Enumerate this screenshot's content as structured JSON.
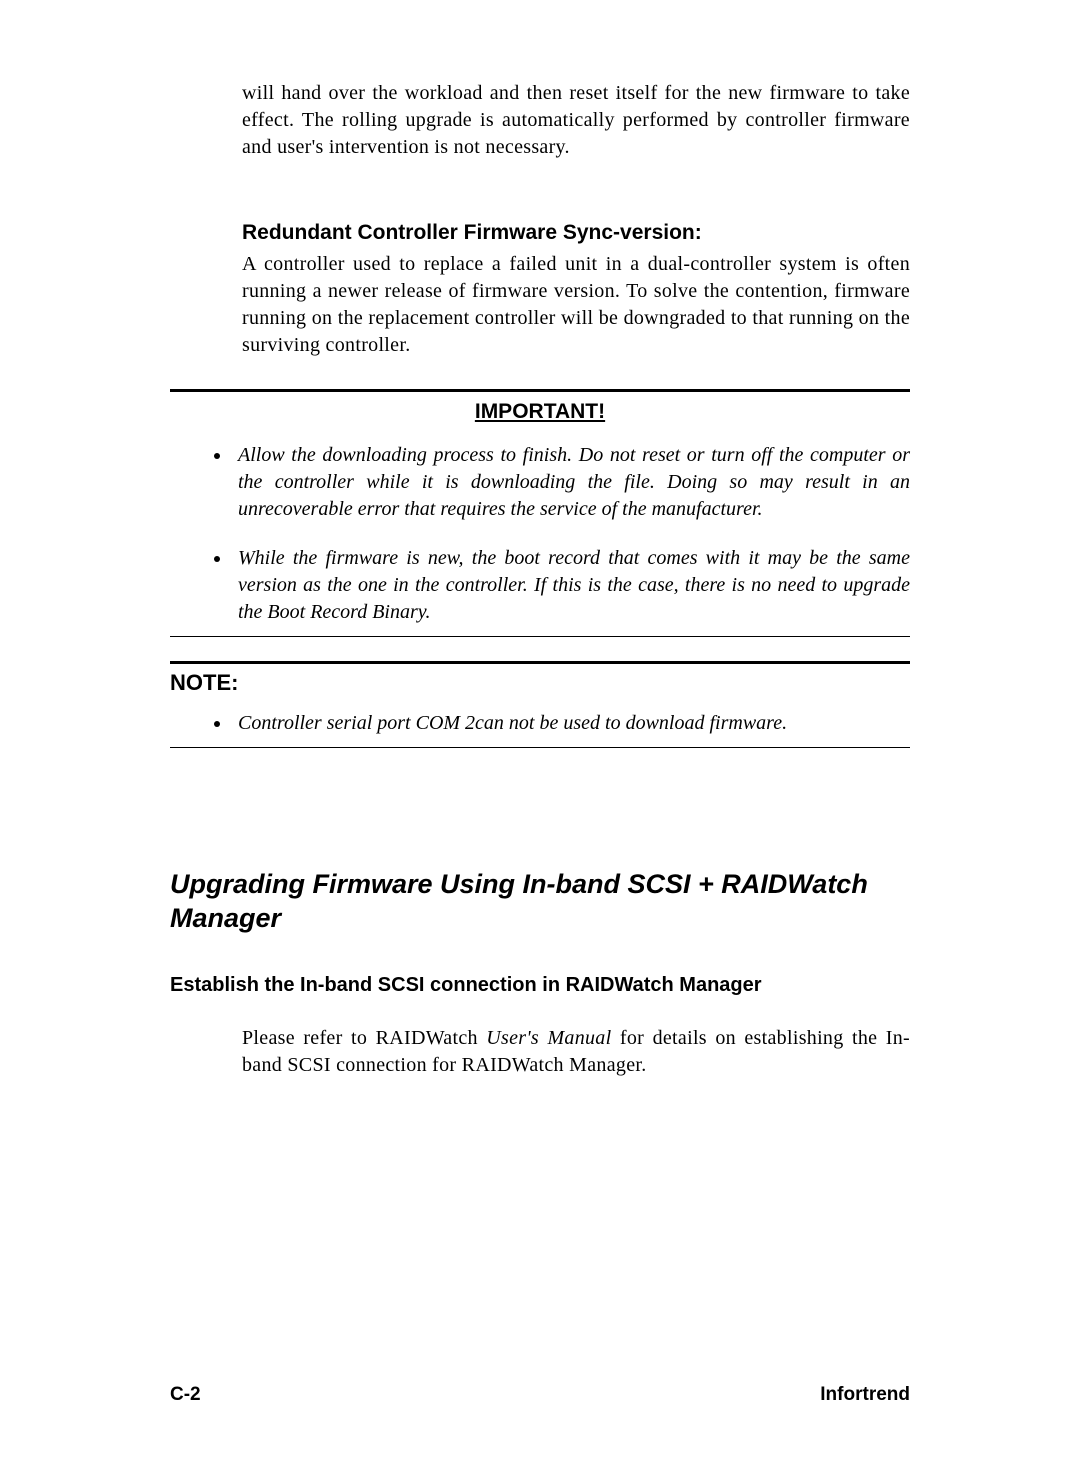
{
  "intro_paragraph": "will hand over the workload and then reset itself for the new firmware to take effect.  The rolling upgrade is automatically performed by controller firmware and user's intervention is not necessary.",
  "redundant": {
    "heading": "Redundant Controller Firmware Sync-version:",
    "body": "A controller used to replace a failed unit in a dual-controller system is often running a newer release of firmware version.  To solve the contention, firmware running on the replacement controller will be downgraded to that running on the surviving controller."
  },
  "important": {
    "title": "IMPORTANT!",
    "items": [
      "Allow the downloading process to finish.  Do not reset or turn off the computer or the controller while it is downloading the file.  Doing so may result in an unrecoverable error that requires the service of the manufacturer.",
      "While the firmware is new, the boot record that comes with it may be the same version as the one in the controller.  If this is the case, there is no need to upgrade the Boot Record Binary."
    ]
  },
  "note": {
    "title": "NOTE:",
    "items": [
      "Controller serial port COM 2can not be used to download firmware."
    ]
  },
  "main_section": {
    "title": "Upgrading Firmware Using In-band SCSI + RAIDWatch Manager",
    "sub_title": "Establish the In-band SCSI connection in RAIDWatch Manager",
    "body_pre": "Please refer to RAIDWatch ",
    "body_italic": "User's Manual",
    "body_post": " for details on establishing the In-band SCSI connection for RAIDWatch Manager."
  },
  "footer": {
    "left": "C-2",
    "right": "Infortrend"
  }
}
